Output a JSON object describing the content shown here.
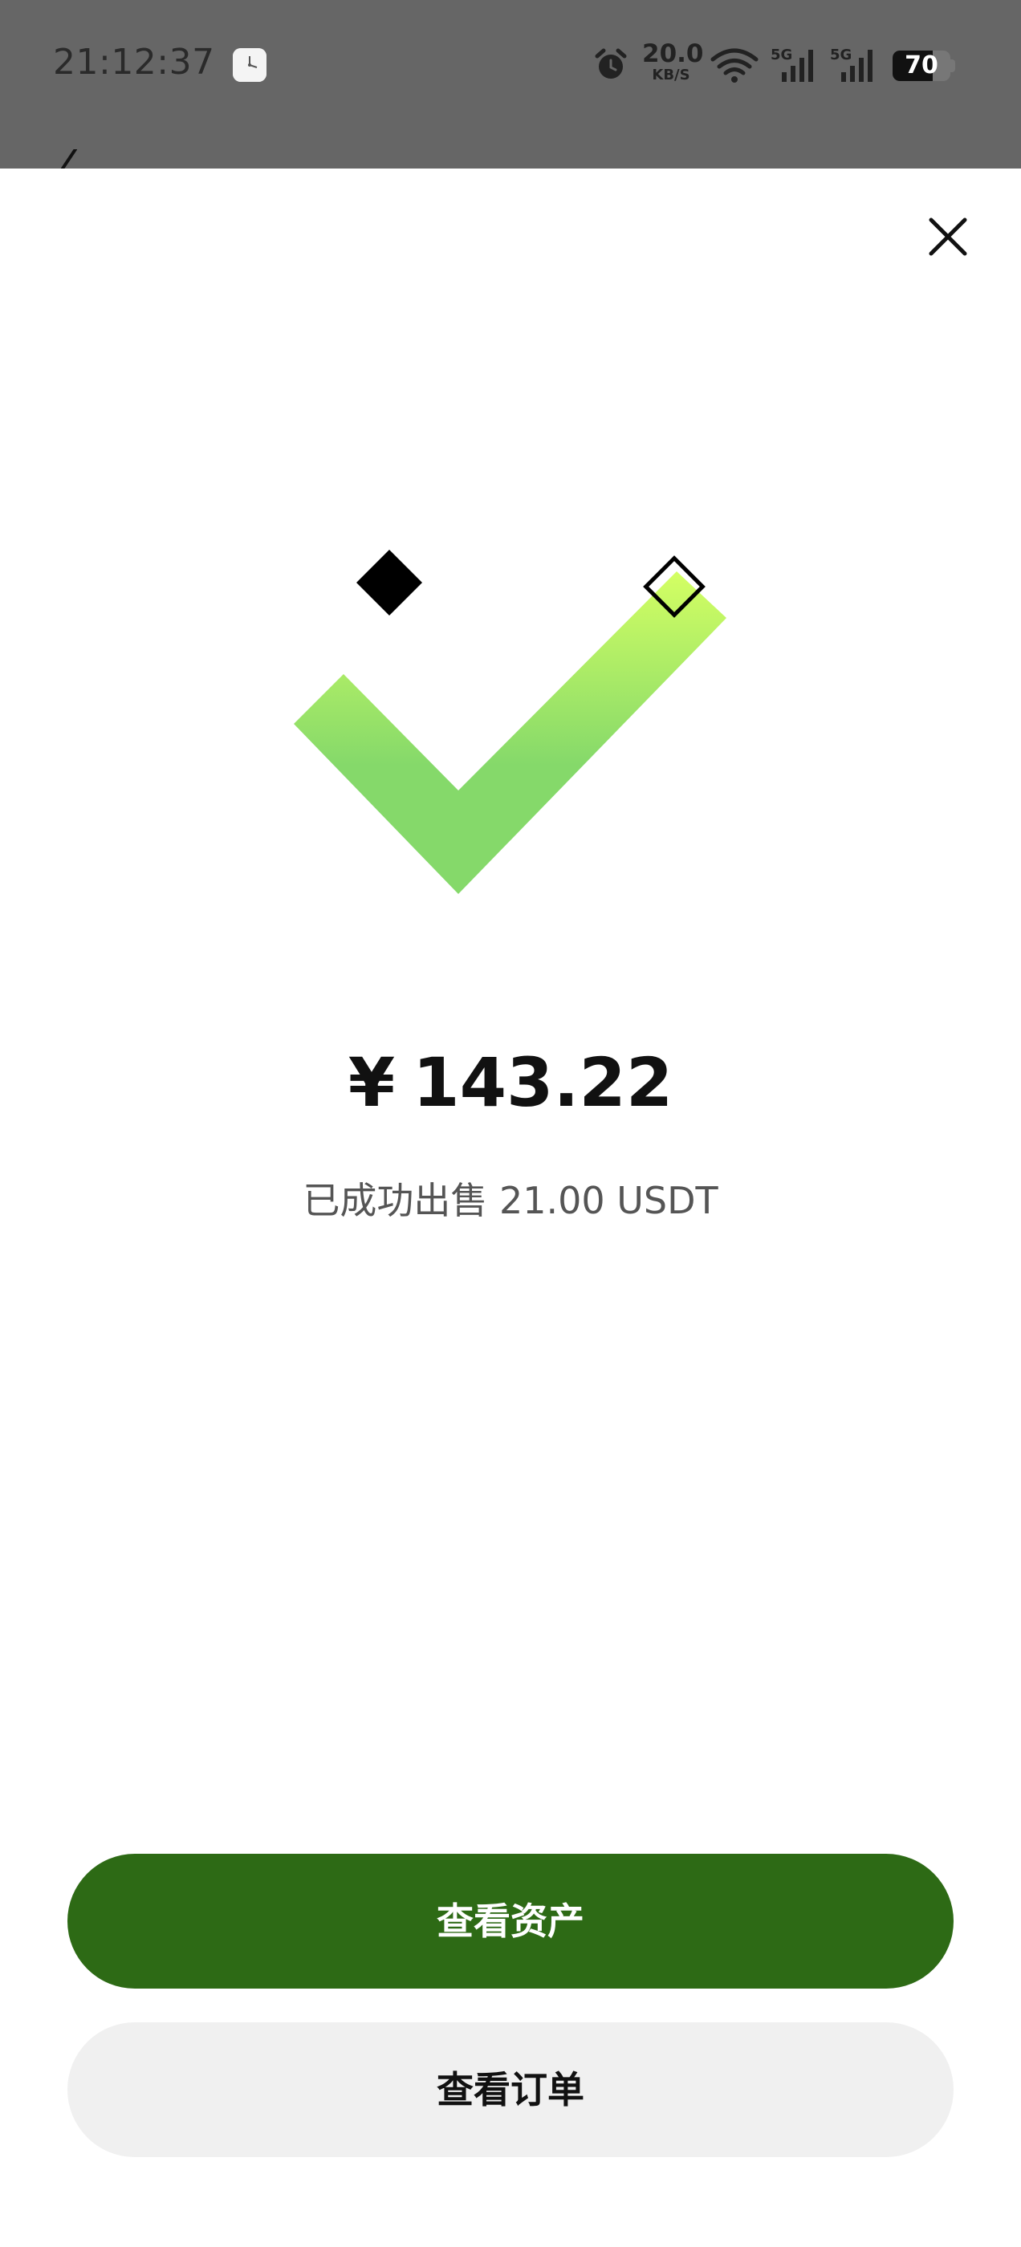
{
  "status_bar": {
    "time": "21:12:37",
    "net_speed_value": "20.0",
    "net_speed_unit": "KB/S",
    "battery_level": "70",
    "battery_percent": 70,
    "icons": [
      "clock-app-icon",
      "alarm-icon",
      "wifi-icon",
      "signal-5g-icon",
      "signal-5g-icon"
    ]
  },
  "success": {
    "currency_symbol": "¥",
    "amount": "143.22",
    "message": "已成功出售 21.00 USDT"
  },
  "actions": {
    "view_assets_label": "查看资产",
    "view_orders_label": "查看订单"
  },
  "colors": {
    "primary_button": "#2d6a15",
    "secondary_button": "#f0f0f0",
    "check_gradient_top": "#d4ff63",
    "check_gradient_bottom": "#85d96a",
    "backdrop": "#666666"
  }
}
